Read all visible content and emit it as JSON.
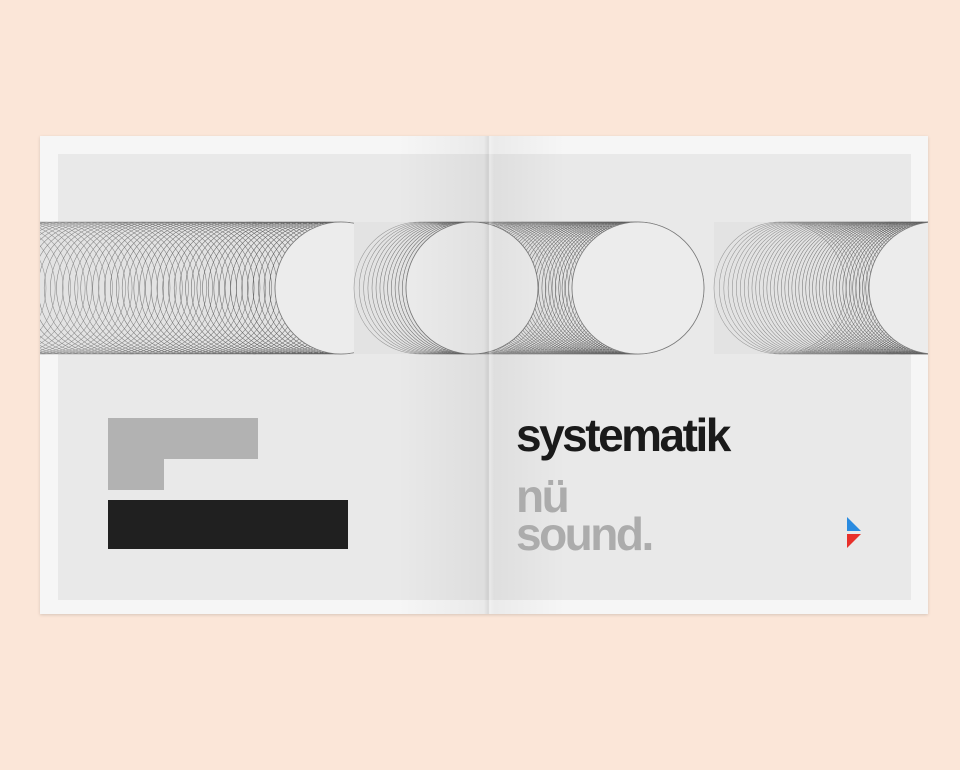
{
  "cover": {
    "title": "systematik",
    "subtitle_line1": "nü",
    "subtitle_line2": "sound."
  },
  "colors": {
    "background": "#fbe6d8",
    "panel": "#e9e9e9",
    "grey_block": "#b2b2b2",
    "black_block": "#202020",
    "logo_blue": "#2a8be0",
    "logo_red": "#e8302a"
  }
}
